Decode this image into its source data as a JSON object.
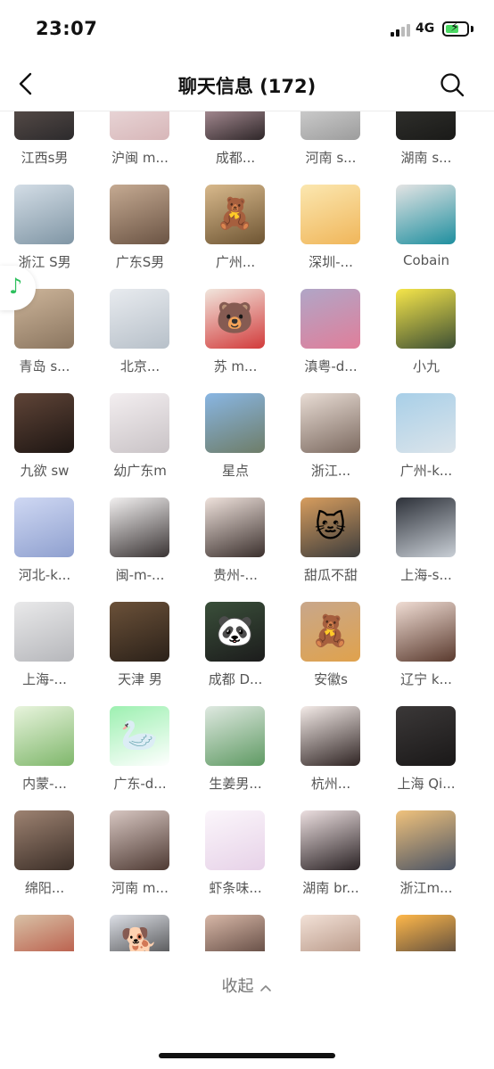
{
  "status_bar": {
    "time": "23:07",
    "network": "4G"
  },
  "header": {
    "title": "聊天信息 (172)"
  },
  "members": [
    {
      "name": "江西s男",
      "palette": [
        "#6b5c55",
        "#2c2a2c"
      ],
      "glyph": ""
    },
    {
      "name": "沪闽 m...",
      "palette": [
        "#f1e5e6",
        "#d7b6b8"
      ],
      "glyph": ""
    },
    {
      "name": "成都...",
      "palette": [
        "#e7c2cc",
        "#2e2628"
      ],
      "glyph": ""
    },
    {
      "name": "河南 s...",
      "palette": [
        "#e5e5e5",
        "#9c9c9c"
      ],
      "glyph": ""
    },
    {
      "name": "湖南 s...",
      "palette": [
        "#3a3a36",
        "#1a1a18"
      ],
      "glyph": ""
    },
    {
      "name": "浙江 S男",
      "palette": [
        "#d3dde6",
        "#8096a5"
      ],
      "glyph": ""
    },
    {
      "name": "广东S男",
      "palette": [
        "#c5aa92",
        "#6b5444"
      ],
      "glyph": ""
    },
    {
      "name": "广州...",
      "palette": [
        "#d8b98c",
        "#6e5533"
      ],
      "glyph": "🧸"
    },
    {
      "name": "深圳-...",
      "palette": [
        "#fbe7b0",
        "#f0b65a"
      ],
      "glyph": ""
    },
    {
      "name": "Cobain",
      "palette": [
        "#e4e4e4",
        "#1f8f9f"
      ],
      "glyph": ""
    },
    {
      "name": "青岛 s...",
      "palette": [
        "#cdb59a",
        "#8b7660"
      ],
      "glyph": ""
    },
    {
      "name": "北京...",
      "palette": [
        "#e8ebef",
        "#b7c0c9"
      ],
      "glyph": ""
    },
    {
      "name": "苏 m...",
      "palette": [
        "#f1e6dd",
        "#d23b3b"
      ],
      "glyph": "🐻"
    },
    {
      "name": "滇粤-d...",
      "palette": [
        "#b0a6c7",
        "#e07e9a"
      ],
      "glyph": ""
    },
    {
      "name": "小九",
      "palette": [
        "#f6e64a",
        "#3d4f34"
      ],
      "glyph": ""
    },
    {
      "name": "九欲 sw",
      "palette": [
        "#5f4437",
        "#1e1613"
      ],
      "glyph": ""
    },
    {
      "name": "幼广东m",
      "palette": [
        "#f3eef0",
        "#c9c3c6"
      ],
      "glyph": ""
    },
    {
      "name": "星点",
      "palette": [
        "#89b6e3",
        "#6e7d68"
      ],
      "glyph": ""
    },
    {
      "name": "浙江...",
      "palette": [
        "#e8dcd4",
        "#7c6a60"
      ],
      "glyph": ""
    },
    {
      "name": "广州-k...",
      "palette": [
        "#a8cfe8",
        "#dbe4ea"
      ],
      "glyph": ""
    },
    {
      "name": "河北-k...",
      "palette": [
        "#cfd8f3",
        "#8fa0cf"
      ],
      "glyph": ""
    },
    {
      "name": "闽-m-...",
      "palette": [
        "#f2f0f0",
        "#3a3434"
      ],
      "glyph": ""
    },
    {
      "name": "贵州-...",
      "palette": [
        "#efe2dc",
        "#3b302d"
      ],
      "glyph": ""
    },
    {
      "name": "甜瓜不甜",
      "palette": [
        "#d79d5e",
        "#3c3c3c"
      ],
      "glyph": "🐱"
    },
    {
      "name": "上海-s...",
      "palette": [
        "#2d3139",
        "#c9cfd6"
      ],
      "glyph": ""
    },
    {
      "name": "上海-...",
      "palette": [
        "#e9e9ea",
        "#b6b7bb"
      ],
      "glyph": ""
    },
    {
      "name": "天津  男",
      "palette": [
        "#6b5139",
        "#2b2119"
      ],
      "glyph": ""
    },
    {
      "name": "成都  D...",
      "palette": [
        "#3a4f3a",
        "#1c1c1c"
      ],
      "glyph": "🐼"
    },
    {
      "name": "安徽s",
      "palette": [
        "#c8a78b",
        "#e0a24c"
      ],
      "glyph": "🧸"
    },
    {
      "name": "辽宁 k...",
      "palette": [
        "#f0ddd4",
        "#5a3a2e"
      ],
      "glyph": ""
    },
    {
      "name": "内蒙-...",
      "palette": [
        "#e8f4dd",
        "#7fb76b"
      ],
      "glyph": ""
    },
    {
      "name": "广东-d...",
      "palette": [
        "#9cf0b0",
        "#ffffff"
      ],
      "glyph": "🦢"
    },
    {
      "name": "生姜男...",
      "palette": [
        "#dfe9e1",
        "#5f9a63"
      ],
      "glyph": ""
    },
    {
      "name": "杭州...",
      "palette": [
        "#f4ebe8",
        "#2f2423"
      ],
      "glyph": ""
    },
    {
      "name": "上海 Qi...",
      "palette": [
        "#3b3838",
        "#1a1818"
      ],
      "glyph": ""
    },
    {
      "name": "绵阳...",
      "palette": [
        "#9d8271",
        "#3c2f28"
      ],
      "glyph": ""
    },
    {
      "name": "河南 m...",
      "palette": [
        "#d7c6c1",
        "#4e3a33"
      ],
      "glyph": ""
    },
    {
      "name": "虾条味...",
      "palette": [
        "#fbf6fb",
        "#e7d2e8"
      ],
      "glyph": ""
    },
    {
      "name": "湖南 br...",
      "palette": [
        "#ecdfe0",
        "#2a2224"
      ],
      "glyph": ""
    },
    {
      "name": "浙江m...",
      "palette": [
        "#f0c27c",
        "#4a5364"
      ],
      "glyph": ""
    },
    {
      "name": "",
      "palette": [
        "#d8c1a6",
        "#b13e2e"
      ],
      "glyph": ""
    },
    {
      "name": "",
      "palette": [
        "#dcdfe6",
        "#2b2b2b"
      ],
      "glyph": "🐕"
    },
    {
      "name": "",
      "palette": [
        "#d7b7a7",
        "#3f2a24"
      ],
      "glyph": ""
    },
    {
      "name": "",
      "palette": [
        "#f2e1d7",
        "#a5806d"
      ],
      "glyph": ""
    },
    {
      "name": "",
      "palette": [
        "#ffb84a",
        "#2a2a3a"
      ],
      "glyph": ""
    }
  ],
  "footer": {
    "collapse_label": "收起"
  }
}
